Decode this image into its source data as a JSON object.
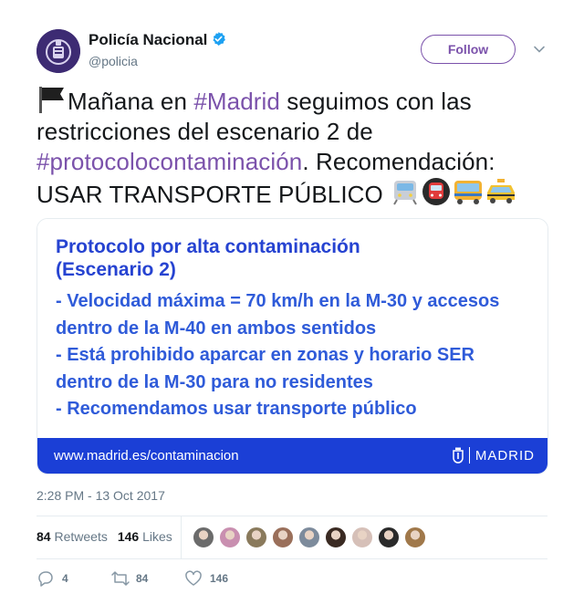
{
  "author": {
    "name": "Policía Nacional",
    "handle": "@policia",
    "avatar_color": "#3d2b73",
    "verified_color": "#1da1f2"
  },
  "follow_label": "Follow",
  "accent_color": "#7b52ab",
  "tweet": {
    "flag_icon": "black-flag-icon",
    "part1": "Mañana en ",
    "hashtag1": "#Madrid",
    "part2": " seguimos con las restricciones del escenario 2 de ",
    "hashtag2": "#protocolocontaminación",
    "part3": ". Recomendación: USAR TRANSPORTE PÚBLICO",
    "transport_icons": [
      "train-icon",
      "metro-icon",
      "bus-icon",
      "taxi-icon"
    ]
  },
  "card": {
    "title_line1": "Protocolo por alta contaminación",
    "title_line2": "(Escenario 2)",
    "lines": [
      "- Velocidad máxima = 70 km/h en la M-30 y accesos",
      "dentro de la M-40 en ambos sentidos",
      "- Está prohibido aparcar en zonas y horario SER",
      "dentro de la M-30 para no residentes",
      "- Recomendamos usar transporte público"
    ],
    "footer_url": "www.madrid.es/contaminacion",
    "footer_brand": "MADRID",
    "footer_color": "#1b3fd6"
  },
  "timestamp": "2:28 PM - 13 Oct 2017",
  "stats": {
    "retweets_count": "84",
    "retweets_label": "Retweets",
    "likes_count": "146",
    "likes_label": "Likes"
  },
  "liker_colors": [
    "#6b6b6b",
    "#c98fb0",
    "#8a7a5c",
    "#9a6f5a",
    "#7d8b9c",
    "#3a2a22",
    "#d6c0b8",
    "#2a2a2a",
    "#a0784a"
  ],
  "actions": {
    "reply_count": "4",
    "retweet_count": "84",
    "like_count": "146"
  }
}
